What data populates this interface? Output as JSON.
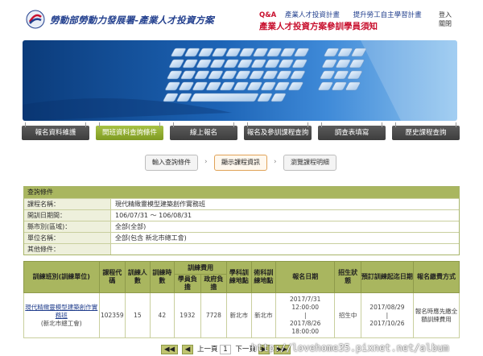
{
  "header": {
    "org_title": "勞動部勞動力發展署-產業人才投資方案",
    "qa_label": "Q&A",
    "link_program": "產業人才投資計畫",
    "link_self_learning": "提升勞工自主學習計畫",
    "notice_title": "產業人才投資方案參訓學員須知",
    "login_line1": "登入",
    "login_line2": "關閉"
  },
  "nav": {
    "tabs": [
      {
        "label": "報名資料維護"
      },
      {
        "label": "開班資料查詢條件"
      },
      {
        "label": "線上報名"
      },
      {
        "label": "報名及參訓課程查詢"
      },
      {
        "label": "調查表填寫"
      },
      {
        "label": "歷史課程查詢"
      }
    ],
    "active_index": 1
  },
  "steps": [
    {
      "label": "輸入查詢條件"
    },
    {
      "label": "顯示課程資訊"
    },
    {
      "label": "瀏覽課程明細"
    }
  ],
  "conditions": {
    "title": "查詢條件",
    "rows": [
      {
        "label": "課程名稱：",
        "value": "現代精緻靈模型建築創作實務班"
      },
      {
        "label": "開訓日期間：",
        "value": "106/07/31 ～ 106/08/31"
      },
      {
        "label": "縣市別(區域)：",
        "value": "全部(全部)"
      },
      {
        "label": "單位名稱：",
        "value": "全部(包含 新北市總工會)"
      },
      {
        "label": "其他條件：",
        "value": ""
      }
    ]
  },
  "table": {
    "headers": {
      "course_class": "訓練班別(訓練單位)",
      "code": "課程代碼",
      "trainees": "訓練人數",
      "hours": "訓練時數",
      "fee_group": "訓練費用",
      "student_fee": "學員負擔",
      "gov_fee": "政府負擔",
      "theory_loc": "學科訓練地點",
      "practice_loc": "術科訓練地點",
      "signup_date": "報名日期",
      "status": "招生狀態",
      "schedule": "預訂訓練起迄日期",
      "payment": "報名繳費方式"
    },
    "rows": [
      {
        "course": "現代精緻靈模型建築創作實務班",
        "unit": "(新北市總工會)",
        "code": "102359",
        "trainees": "15",
        "hours": "42",
        "student_fee": "1932",
        "gov_fee": "7728",
        "theory_loc": "新北市",
        "practice_loc": "新北市",
        "signup_start": "2017/7/31",
        "signup_start_time": "12:00:00",
        "signup_sep": "|",
        "signup_end": "2017/8/26",
        "signup_end_time": "18:00:00",
        "status": "招生中",
        "train_start": "2017/08/29",
        "train_sep": "|",
        "train_end": "2017/10/26",
        "payment": "報名時應先繳全額訓練費用"
      }
    ]
  },
  "pager": {
    "first": "◀◀",
    "prev_icon": "◀",
    "prev": "上一頁",
    "current": "1",
    "next": "下一頁",
    "next_icon": "▶",
    "last": "▶▶"
  },
  "watermark": "http://lovehome35.pixnet.net/album"
}
